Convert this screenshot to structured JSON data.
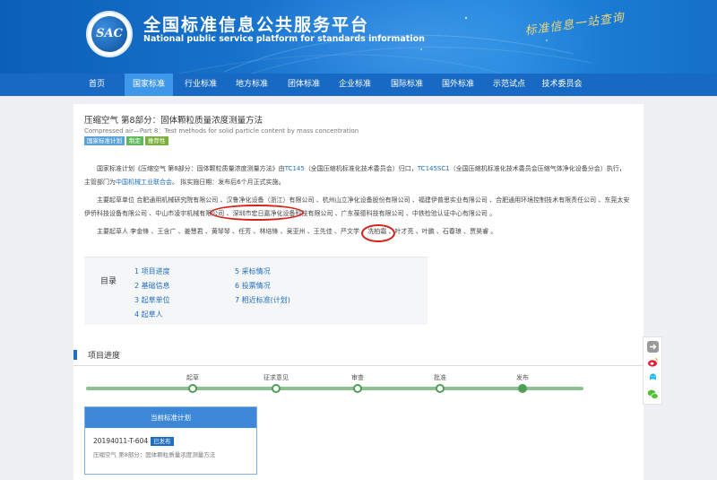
{
  "header": {
    "logo_text": "SAC",
    "title_cn": "全国标准信息公共服务平台",
    "title_en": "National public service platform  for standards information",
    "slogan": "标准信息一站查询"
  },
  "nav": {
    "items": [
      {
        "label": "首页"
      },
      {
        "label": "国家标准"
      },
      {
        "label": "行业标准"
      },
      {
        "label": "地方标准"
      },
      {
        "label": "团体标准"
      },
      {
        "label": "企业标准"
      },
      {
        "label": "国际标准"
      },
      {
        "label": "国外标准"
      },
      {
        "label": "示范试点"
      },
      {
        "label": "技术委员会"
      }
    ],
    "active_index": 1
  },
  "standard": {
    "title": "压缩空气 第8部分：固体颗粒质量浓度测量方法",
    "title_en": "Compressed air—Part 8：Test methods for solid particle content by mass concentration",
    "badges": [
      "国家标准计划",
      "制定",
      "推荐性"
    ]
  },
  "intro": {
    "p1": "国家标准计划《压缩空气 第8部分：固体颗粒质量浓度测量方法》由",
    "tc1": "TC145",
    "p2": "（全国压缩机标准化技术委员会）归口，",
    "tc2": "TC145SC1",
    "p3": "（全国压缩机标准化技术委员会压缩气体净化设备分会）执行，主管部门为",
    "dept": "中国机械工业联合会",
    "p4": "。 拟实施日期：发布后6个月正式实施。"
  },
  "drafting_units": {
    "label": "主要起草单位",
    "text": "合肥通用机械研究院有限公司 、汉鲁净化设备（浙江）有限公司 、杭州山立净化设备股份有限公司 、福建伊普思实业有限公司 、合肥通用环境控制技术有限责任公司 、东莞太安伊侨科技设备有限公司 、中山市凌宇机械有限公司 、深圳市宏日嘉净化设备科技有限公司 、广东葆德科技有限公司 、中铁检验认证中心有限公司 。"
  },
  "drafters": {
    "label": "主要起草人",
    "text": "李金锋 、王含广 、姜慧君 、黄琴琴 、任芳 、林培锋 、吴亚州 、王先佳 、严文学 、冼柏霜 、叶才亮 、叶鹏 、石春琅 、贾昊睿 。"
  },
  "toc": {
    "label": "目录",
    "items": [
      "1 项目进度",
      "2 基础信息",
      "3 起草单位",
      "4 起草人",
      "5 采标情况",
      "6 投票情况",
      "7 相近标准(计划)"
    ]
  },
  "progress": {
    "title": "项目进度",
    "steps": [
      "起草",
      "征求意见",
      "审查",
      "批准",
      "发布"
    ],
    "current_step": "发布"
  },
  "plan_card": {
    "header": "当前标准计划",
    "code": "20194011-T-604",
    "status": "已发布",
    "name": "压缩空气 第8部分：固体颗粒质量浓度测量方法"
  },
  "side_icons": [
    "share-icon",
    "weibo-icon",
    "qq-icon",
    "wechat-icon"
  ],
  "colors": {
    "header_blue": "#1b78d3",
    "nav_blue": "#1769c4",
    "nav_active": "#3f97ea",
    "link_blue": "#1f6ec0",
    "annotation_red": "#d4241c",
    "progress_green": "#4e9e57"
  }
}
